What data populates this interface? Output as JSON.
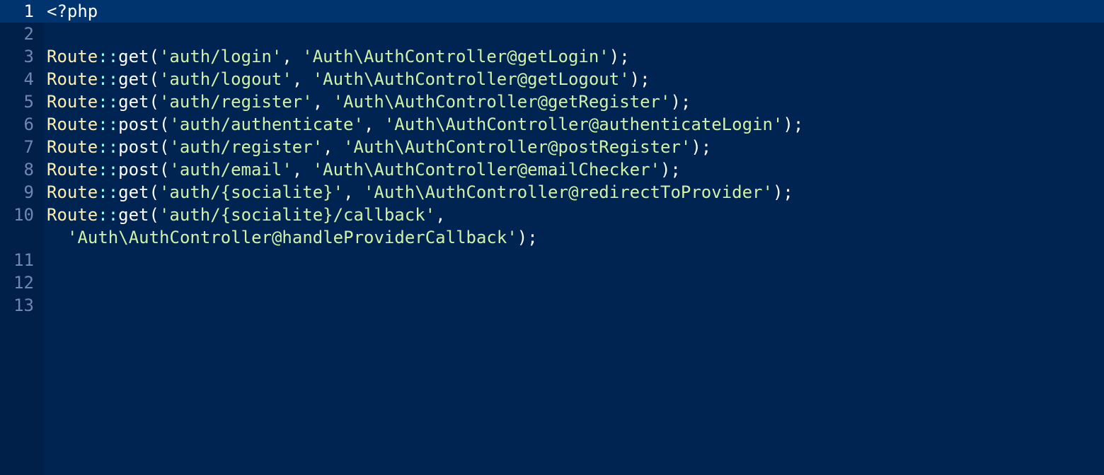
{
  "editor": {
    "language": "php",
    "colors": {
      "background": "#002451",
      "gutter_background": "#00204a",
      "current_line": "#00346e",
      "line_number": "#7285b7",
      "plain": "#ffffff",
      "class": "#ffeead",
      "operator": "#99ffff",
      "string": "#d1f1a9"
    },
    "lines": [
      {
        "num": "1",
        "open_tag": "<?php"
      },
      {
        "num": "2"
      },
      {
        "num": "3",
        "cls": "Route",
        "op": "::",
        "fn": "get",
        "open": "(",
        "s1": "'auth/login'",
        "sep": ", ",
        "s2": "'Auth\\AuthController@getLogin'",
        "close": ");"
      },
      {
        "num": "4",
        "cls": "Route",
        "op": "::",
        "fn": "get",
        "open": "(",
        "s1": "'auth/logout'",
        "sep": ", ",
        "s2": "'Auth\\AuthController@getLogout'",
        "close": ");"
      },
      {
        "num": "5",
        "cls": "Route",
        "op": "::",
        "fn": "get",
        "open": "(",
        "s1": "'auth/register'",
        "sep": ", ",
        "s2": "'Auth\\AuthController@getRegister'",
        "close": ");"
      },
      {
        "num": "6",
        "cls": "Route",
        "op": "::",
        "fn": "post",
        "open": "(",
        "s1": "'auth/authenticate'",
        "sep": ", ",
        "s2": "'Auth\\AuthController@authenticateLogin'",
        "close": ");"
      },
      {
        "num": "7",
        "cls": "Route",
        "op": "::",
        "fn": "post",
        "open": "(",
        "s1": "'auth/register'",
        "sep": ", ",
        "s2": "'Auth\\AuthController@postRegister'",
        "close": ");"
      },
      {
        "num": "8",
        "cls": "Route",
        "op": "::",
        "fn": "post",
        "open": "(",
        "s1": "'auth/email'",
        "sep": ", ",
        "s2": "'Auth\\AuthController@emailChecker'",
        "close": ");"
      },
      {
        "num": "9",
        "cls": "Route",
        "op": "::",
        "fn": "get",
        "open": "(",
        "s1": "'auth/{socialite}'",
        "sep": ", ",
        "s2": "'Auth\\AuthController@redirectToProvider'",
        "close": ");"
      },
      {
        "num": "10",
        "cls": "Route",
        "op": "::",
        "fn": "get",
        "open": "(",
        "s1": "'auth/{socialite}/callback'",
        "sep": ",",
        "s2": "'Auth\\AuthController@handleProviderCallback'",
        "close": ");"
      },
      {
        "num": "11"
      },
      {
        "num": "12"
      },
      {
        "num": "13"
      }
    ]
  }
}
